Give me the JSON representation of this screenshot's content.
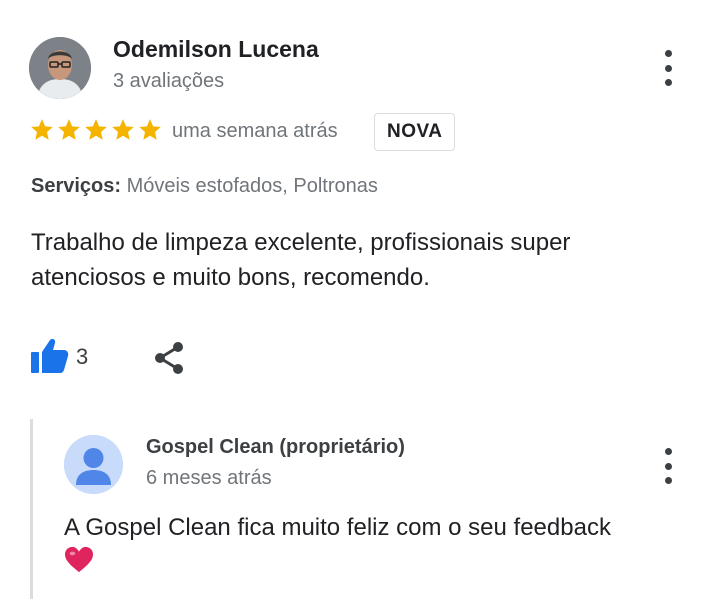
{
  "review": {
    "author": "Odemilson Lucena",
    "author_meta": "3 avaliações",
    "rating": 5,
    "time": "uma semana atrás",
    "badge": "NOVA",
    "services_label": "Serviços:",
    "services_value": "Móveis estofados, Poltronas",
    "text": "Trabalho de limpeza excelente, profissionais super atenciosos e muito bons, recomendo.",
    "likes": "3",
    "icons": {
      "like": "thumbs-up-icon",
      "share": "share-icon",
      "more": "more-vert-icon",
      "star": "star-icon"
    }
  },
  "reply": {
    "author": "Gospel Clean (proprietário)",
    "time": "6 meses atrás",
    "text": "A Gospel Clean fica muito feliz com o seu feedback",
    "emoji": "heart-emoji"
  },
  "colors": {
    "star": "#f4b400",
    "like_blue": "#1a73e8",
    "owner_avatar_bg": "#c8dbfa",
    "owner_avatar_fg": "#4f86e8",
    "heart": "#e0245e"
  }
}
